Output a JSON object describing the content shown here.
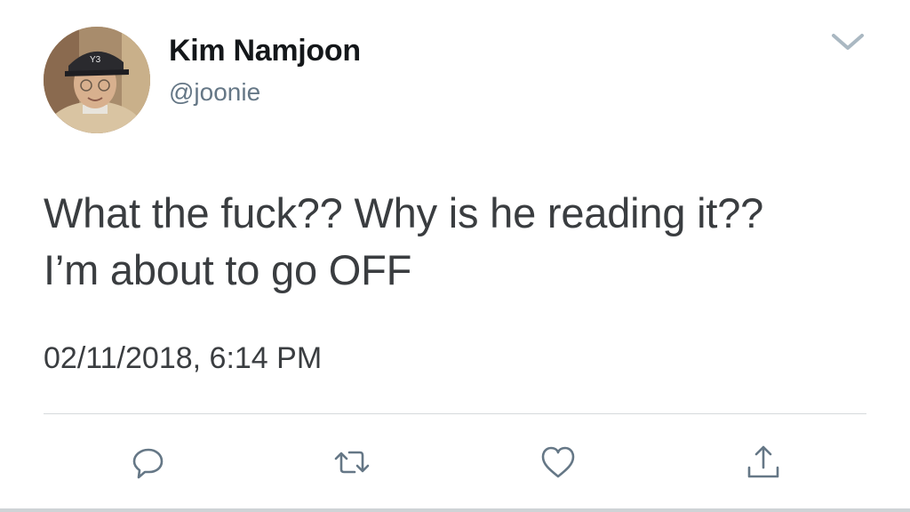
{
  "tweet": {
    "author": {
      "display_name": "Kim Namjoon",
      "handle": "@joonie"
    },
    "text": "What the fuck?? Why is he reading it??\nI’m about to go OFF",
    "timestamp": "02/11/2018, 6:14 PM"
  },
  "icons": {
    "menu": "chevron-down-icon",
    "reply": "reply-icon",
    "retweet": "retweet-icon",
    "like": "heart-icon",
    "share": "share-icon"
  },
  "colors": {
    "text": "#3a3d40",
    "secondary": "#657786",
    "icon": "#657786"
  }
}
